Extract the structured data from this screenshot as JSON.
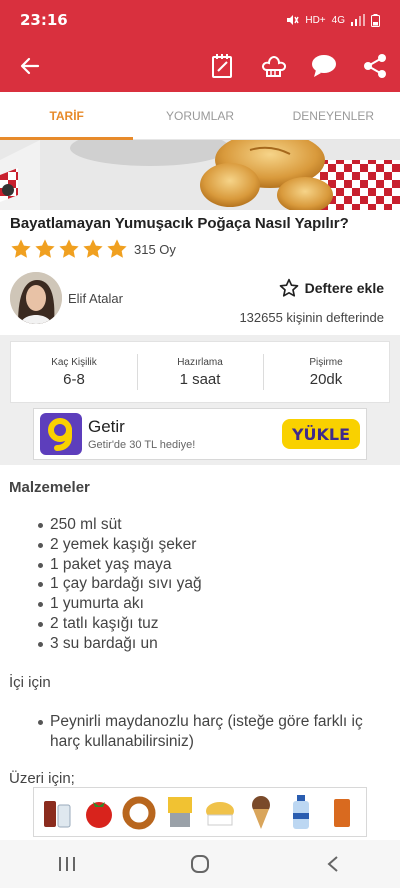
{
  "status": {
    "time": "23:16",
    "network": "4G",
    "indicator": "HD+"
  },
  "tabs": [
    {
      "label": "TARİF",
      "active": true
    },
    {
      "label": "YORUMLAR",
      "active": false
    },
    {
      "label": "DENEYENLER",
      "active": false
    }
  ],
  "recipe": {
    "title": "Bayatlamayan Yumuşacık Poğaça Nasıl Yapılır?",
    "stars": 5,
    "rating_count": "315 Oy",
    "author": "Elif Atalar",
    "bookmark_label": "Deftere ekle",
    "bookmark_count": "132655 kişinin defterinde"
  },
  "info": [
    {
      "label": "Kaç Kişilik",
      "value": "6-8"
    },
    {
      "label": "Hazırlama",
      "value": "1 saat"
    },
    {
      "label": "Pişirme",
      "value": "20dk"
    }
  ],
  "ad": {
    "logo_letter": "g",
    "title": "Getir",
    "subtitle": "Getir'de 30 TL hediye!",
    "button": "YÜKLE"
  },
  "ingredients_heading": "Malzemeler",
  "ingredients": [
    "250 ml süt",
    "2 yemek kaşığı şeker",
    "1 paket yaş maya",
    "1 çay bardağı sıvı yağ",
    "1 yumurta akı",
    "2 tatlı kaşığı tuz",
    "3 su bardağı un"
  ],
  "filling_heading": "İçi için",
  "filling": [
    "Peynirli maydanozlu harç (isteğe göre farklı iç harç kullanabilirsiniz)"
  ],
  "topping_heading": "Üzeri için;",
  "colors": {
    "brand_red": "#d9303e",
    "accent_orange": "#e78a2a",
    "star": "#f0a020",
    "getir_purple": "#5d3ebc",
    "getir_yellow": "#f9d100"
  },
  "icons": {
    "back": "arrow-left-icon",
    "notes": "notepad-icon",
    "chef": "chef-hat-icon",
    "comment": "chat-bubble-icon",
    "share": "share-icon",
    "bookmark": "star-outline-icon"
  }
}
